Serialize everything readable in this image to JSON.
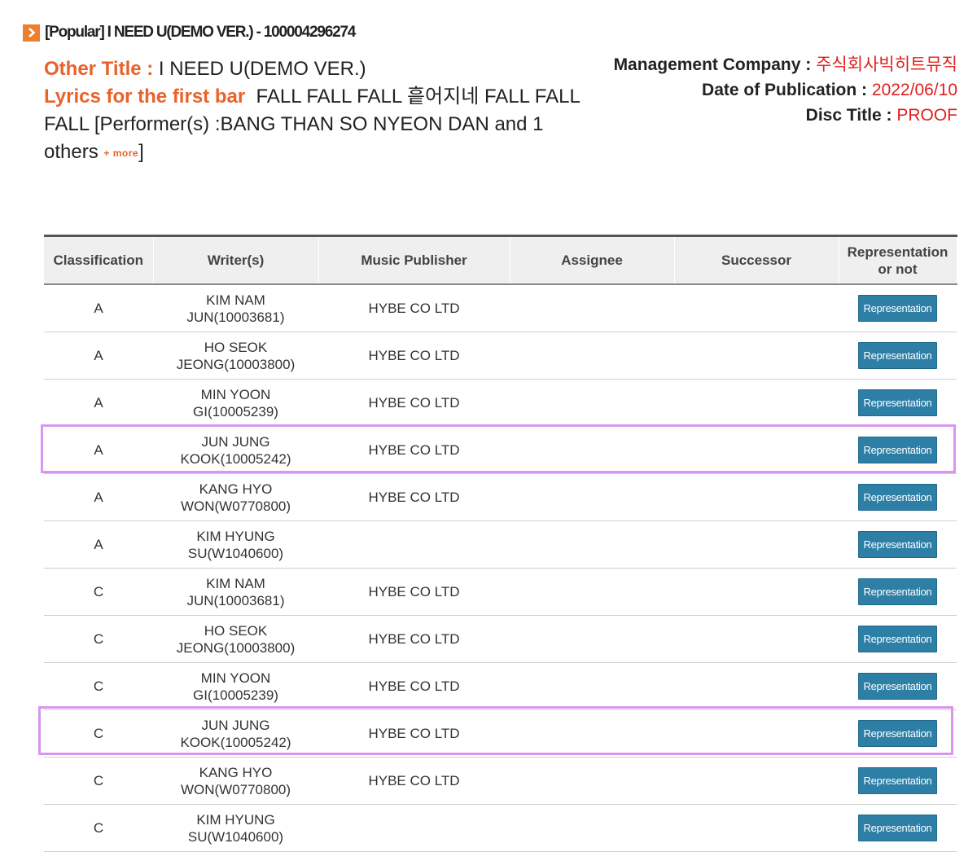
{
  "header": {
    "title": "[Popular] I NEED U(DEMO VER.) - 100004296274"
  },
  "info": {
    "other_title_label": "Other Title :",
    "other_title_value": "I NEED U(DEMO VER.)",
    "lyrics_label": "Lyrics for the first bar",
    "lyrics_value": "FALL FALL FALL 흩어지네 FALL FALL FALL [Performer(s) :BANG THAN SO NYEON DAN and 1 others",
    "more_label": "+ more",
    "lyrics_close": "]"
  },
  "meta": {
    "management_label": "Management Company :",
    "management_value": "주식회사빅히트뮤직",
    "date_label": "Date of Publication :",
    "date_value": "2022/06/10",
    "disc_label": "Disc Title :",
    "disc_value": "PROOF"
  },
  "table": {
    "headers": [
      "Classification",
      "Writer(s)",
      "Music Publisher",
      "Assignee",
      "Successor",
      "Representation or not"
    ],
    "rows": [
      {
        "classification": "A",
        "writer_line1": "KIM NAM",
        "writer_line2": "JUN(10003681)",
        "publisher": "HYBE CO LTD",
        "assignee": "",
        "successor": "",
        "rep": "Representation"
      },
      {
        "classification": "A",
        "writer_line1": "HO SEOK",
        "writer_line2": "JEONG(10003800)",
        "publisher": "HYBE CO LTD",
        "assignee": "",
        "successor": "",
        "rep": "Representation"
      },
      {
        "classification": "A",
        "writer_line1": "MIN YOON",
        "writer_line2": "GI(10005239)",
        "publisher": "HYBE CO LTD",
        "assignee": "",
        "successor": "",
        "rep": "Representation"
      },
      {
        "classification": "A",
        "writer_line1": "JUN JUNG",
        "writer_line2": "KOOK(10005242)",
        "publisher": "HYBE CO LTD",
        "assignee": "",
        "successor": "",
        "rep": "Representation"
      },
      {
        "classification": "A",
        "writer_line1": "KANG HYO",
        "writer_line2": "WON(W0770800)",
        "publisher": "HYBE CO LTD",
        "assignee": "",
        "successor": "",
        "rep": "Representation"
      },
      {
        "classification": "A",
        "writer_line1": "KIM HYUNG",
        "writer_line2": "SU(W1040600)",
        "publisher": "",
        "assignee": "",
        "successor": "",
        "rep": "Representation"
      },
      {
        "classification": "C",
        "writer_line1": "KIM NAM",
        "writer_line2": "JUN(10003681)",
        "publisher": "HYBE CO LTD",
        "assignee": "",
        "successor": "",
        "rep": "Representation"
      },
      {
        "classification": "C",
        "writer_line1": "HO SEOK",
        "writer_line2": "JEONG(10003800)",
        "publisher": "HYBE CO LTD",
        "assignee": "",
        "successor": "",
        "rep": "Representation"
      },
      {
        "classification": "C",
        "writer_line1": "MIN YOON",
        "writer_line2": "GI(10005239)",
        "publisher": "HYBE CO LTD",
        "assignee": "",
        "successor": "",
        "rep": "Representation"
      },
      {
        "classification": "C",
        "writer_line1": "JUN JUNG",
        "writer_line2": "KOOK(10005242)",
        "publisher": "HYBE CO LTD",
        "assignee": "",
        "successor": "",
        "rep": "Representation"
      },
      {
        "classification": "C",
        "writer_line1": "KANG HYO",
        "writer_line2": "WON(W0770800)",
        "publisher": "HYBE CO LTD",
        "assignee": "",
        "successor": "",
        "rep": "Representation"
      },
      {
        "classification": "C",
        "writer_line1": "KIM HYUNG",
        "writer_line2": "SU(W1040600)",
        "publisher": "",
        "assignee": "",
        "successor": "",
        "rep": "Representation"
      }
    ]
  },
  "colors": {
    "accent_orange": "#e8622a",
    "value_red": "#e02020",
    "button_blue": "#2d7fa6",
    "highlight_purple": "#d896ee"
  }
}
